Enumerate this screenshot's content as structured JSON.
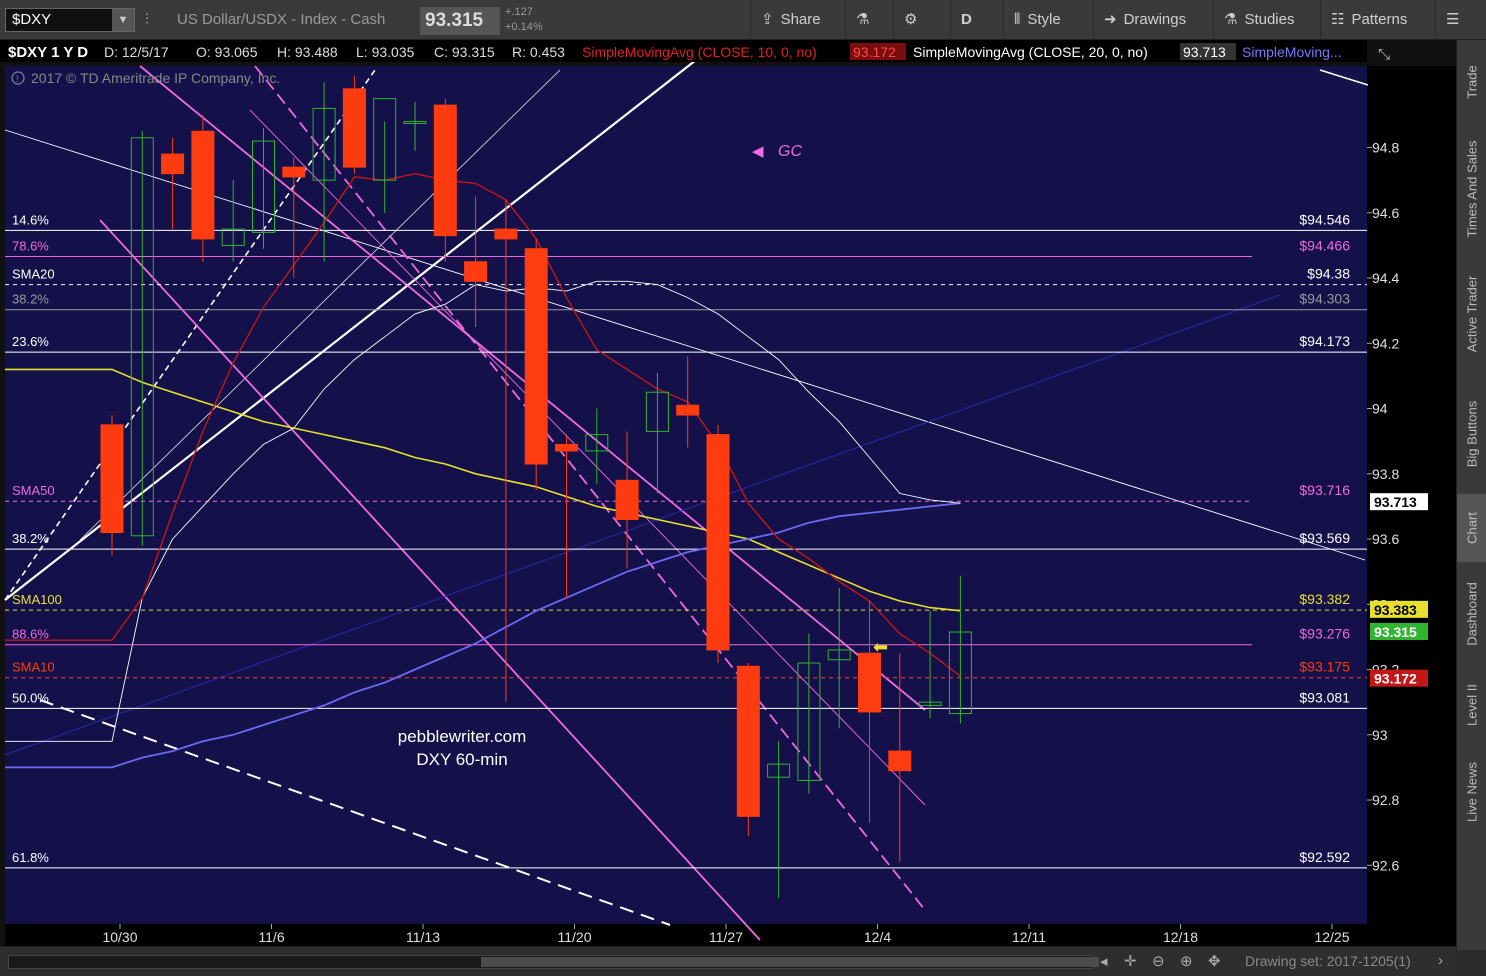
{
  "toolbar": {
    "symbol": "$DXY",
    "description": "US Dollar/USDX - Index - Cash",
    "last_price": "93.315",
    "change_abs": "+.127",
    "change_pct": "+0.14%",
    "share_label": "Share",
    "period_label": "D",
    "style_label": "Style",
    "drawings_label": "Drawings",
    "studies_label": "Studies",
    "patterns_label": "Patterns",
    "icons": [
      "flask-icon",
      "gear-icon",
      "share-icon",
      "drawings-icon",
      "studies-icon",
      "patterns-icon",
      "menu-icon",
      "link-icon"
    ]
  },
  "header": {
    "symbol_period": "$DXY 1 Y D",
    "date": "D: 12/5/17",
    "open": "O: 93.065",
    "high": "H: 93.488",
    "low": "L: 93.035",
    "close": "C: 93.315",
    "range": "R: 0.453",
    "sma10_label": "SimpleMovingAvg (CLOSE, 10, 0, no)",
    "sma10_value": "93.172",
    "sma20_label": "SimpleMovingAvg (CLOSE, 20, 0, no)",
    "sma20_value": "93.713",
    "sma_more": "SimpleMoving...",
    "copyright": "2017 © TD Ameritrade IP Company, Inc."
  },
  "side_tabs": [
    "Trade",
    "Times And Sales",
    "Active Trader",
    "Big Buttons",
    "Chart",
    "Dashboard",
    "Level II",
    "Live News"
  ],
  "active_side_tab": "Chart",
  "bottom": {
    "drawing_set": "Drawing set: 2017-1205(1)"
  },
  "colors": {
    "background": "#14104a",
    "up": "#2fb52f",
    "down": "#ff3c0f",
    "sma10": "#c41616",
    "sma20": "#ffffff",
    "sma50": "#6a6af2",
    "sma100": "#e6e02c",
    "fib": "#f06ae0",
    "level": "#ffffff"
  },
  "chart_data": {
    "type": "candlestick",
    "y_ticks": [
      92.6,
      92.8,
      93,
      93.2,
      93.4,
      93.6,
      93.8,
      94,
      94.2,
      94.4,
      94.6,
      94.8
    ],
    "ylim": [
      92.42,
      95.05
    ],
    "x_ticks": [
      "10/30",
      "11/6",
      "11/13",
      "11/20",
      "11/27",
      "12/4",
      "12/11",
      "12/18",
      "12/25"
    ],
    "candles": [
      {
        "o": 93.95,
        "h": 93.98,
        "l": 93.55,
        "c": 93.62
      },
      {
        "o": 93.61,
        "h": 94.85,
        "l": 93.58,
        "c": 94.83
      },
      {
        "o": 94.78,
        "h": 94.83,
        "l": 94.55,
        "c": 94.72
      },
      {
        "o": 94.85,
        "h": 94.9,
        "l": 94.45,
        "c": 94.52
      },
      {
        "o": 94.5,
        "h": 94.7,
        "l": 94.45,
        "c": 94.55
      },
      {
        "o": 94.54,
        "h": 94.86,
        "l": 94.49,
        "c": 94.82
      },
      {
        "o": 94.74,
        "h": 94.77,
        "l": 94.4,
        "c": 94.71
      },
      {
        "o": 94.7,
        "h": 95.0,
        "l": 94.45,
        "c": 94.92
      },
      {
        "o": 94.98,
        "h": 95.02,
        "l": 94.72,
        "c": 94.74
      },
      {
        "o": 94.7,
        "h": 94.88,
        "l": 94.6,
        "c": 94.95
      },
      {
        "o": 94.88,
        "h": 94.94,
        "l": 94.79,
        "c": 94.88
      },
      {
        "o": 94.93,
        "h": 94.95,
        "l": 94.45,
        "c": 94.53
      },
      {
        "o": 94.45,
        "h": 94.65,
        "l": 94.25,
        "c": 94.39
      },
      {
        "o": 94.55,
        "h": 94.64,
        "l": 93.1,
        "c": 94.52
      },
      {
        "o": 94.49,
        "h": 94.52,
        "l": 93.75,
        "c": 93.83
      },
      {
        "o": 93.89,
        "h": 93.92,
        "l": 93.42,
        "c": 93.87
      },
      {
        "o": 93.87,
        "h": 94.0,
        "l": 93.77,
        "c": 93.92
      },
      {
        "o": 93.78,
        "h": 93.93,
        "l": 93.51,
        "c": 93.66
      },
      {
        "o": 93.93,
        "h": 94.11,
        "l": 93.74,
        "c": 94.05
      },
      {
        "o": 94.01,
        "h": 94.16,
        "l": 93.88,
        "c": 93.98
      },
      {
        "o": 93.92,
        "h": 93.95,
        "l": 93.22,
        "c": 93.26
      },
      {
        "o": 93.21,
        "h": 93.22,
        "l": 92.69,
        "c": 92.75
      },
      {
        "o": 92.87,
        "h": 92.98,
        "l": 92.5,
        "c": 92.91
      },
      {
        "o": 92.86,
        "h": 93.31,
        "l": 92.82,
        "c": 93.22
      },
      {
        "o": 93.23,
        "h": 93.45,
        "l": 93.02,
        "c": 93.26
      },
      {
        "o": 93.25,
        "h": 93.41,
        "l": 92.73,
        "c": 93.07
      },
      {
        "o": 92.95,
        "h": 93.25,
        "l": 92.61,
        "c": 92.89
      },
      {
        "o": 93.09,
        "h": 93.38,
        "l": 93.05,
        "c": 93.1
      },
      {
        "o": 93.065,
        "h": 93.488,
        "l": 93.035,
        "c": 93.315
      }
    ],
    "sma10": [
      93.29,
      93.42,
      93.68,
      93.93,
      94.14,
      94.31,
      94.44,
      94.57,
      94.71,
      94.7,
      94.72,
      94.7,
      94.69,
      94.64,
      94.52,
      94.34,
      94.18,
      94.12,
      94.06,
      94.02,
      93.89,
      93.71,
      93.6,
      93.54,
      93.47,
      93.41,
      93.31,
      93.25,
      93.18
    ],
    "sma20": [
      92.98,
      93.42,
      93.6,
      93.7,
      93.8,
      93.89,
      93.94,
      94.06,
      94.15,
      94.22,
      94.29,
      94.32,
      94.38,
      94.36,
      94.37,
      94.36,
      94.39,
      94.39,
      94.38,
      94.34,
      94.29,
      94.22,
      94.15,
      94.05,
      93.96,
      93.85,
      93.74,
      93.72,
      93.71
    ],
    "sma50": [
      92.9,
      92.93,
      92.95,
      92.98,
      93.0,
      93.03,
      93.06,
      93.09,
      93.13,
      93.16,
      93.2,
      93.24,
      93.28,
      93.33,
      93.38,
      93.42,
      93.46,
      93.5,
      93.53,
      93.56,
      93.58,
      93.6,
      93.62,
      93.65,
      93.67,
      93.68,
      93.69,
      93.7,
      93.71
    ],
    "sma100": [
      94.12,
      94.08,
      94.05,
      94.02,
      93.99,
      93.96,
      93.94,
      93.92,
      93.9,
      93.88,
      93.85,
      93.83,
      93.8,
      93.78,
      93.76,
      93.73,
      93.7,
      93.68,
      93.66,
      93.64,
      93.62,
      93.6,
      93.56,
      93.52,
      93.48,
      93.44,
      93.41,
      93.39,
      93.38
    ],
    "levels": [
      {
        "left": "14.6%",
        "value": 94.546,
        "right": "$94.546",
        "color": "#ffffff",
        "dash": false
      },
      {
        "left": "78.6%",
        "value": 94.466,
        "right": "$94.466",
        "color": "#f06ae0",
        "dash": false
      },
      {
        "left": "SMA20",
        "value": 94.38,
        "right": "$94.38",
        "color": "#ffffff",
        "dash": true
      },
      {
        "left": "38.2%",
        "value": 94.303,
        "right": "$94.303",
        "color": "#9a9a9a",
        "dash": false
      },
      {
        "left": "23.6%",
        "value": 94.173,
        "right": "$94.173",
        "color": "#ffffff",
        "dash": false
      },
      {
        "left": "SMA50",
        "value": 93.716,
        "right": "$93.716",
        "color": "#f06ae0",
        "dash": true
      },
      {
        "left": "38.2%",
        "value": 93.569,
        "right": "$93.569",
        "color": "#ffffff",
        "dash": false
      },
      {
        "left": "SMA100",
        "value": 93.382,
        "right": "$93.382",
        "color": "#e6e02c",
        "dash": true
      },
      {
        "left": "88.6%",
        "value": 93.276,
        "right": "$93.276",
        "color": "#f06ae0",
        "dash": false
      },
      {
        "left": "SMA10",
        "value": 93.175,
        "right": "$93.175",
        "color": "#ff3c0f",
        "dash": true
      },
      {
        "left": "50.0%",
        "value": 93.081,
        "right": "$93.081",
        "color": "#ffffff",
        "dash": false
      },
      {
        "left": "61.8%",
        "value": 92.592,
        "right": "$92.592",
        "color": "#ffffff",
        "dash": false
      }
    ],
    "price_badges": [
      {
        "value": 93.713,
        "label": "93.713",
        "bg": "#ffffff",
        "fg": "#000000"
      },
      {
        "value": 93.383,
        "label": "93.383",
        "bg": "#e6e02c",
        "fg": "#000000"
      },
      {
        "value": 93.315,
        "label": "93.315",
        "bg": "#2fb52f",
        "fg": "#ffffff"
      },
      {
        "value": 93.172,
        "label": "93.172",
        "bg": "#c41616",
        "fg": "#ffffff"
      }
    ],
    "annotations": {
      "gc": "GC",
      "watermark_line1": "pebblewriter.com",
      "watermark_line2": "DXY 60-min"
    }
  }
}
